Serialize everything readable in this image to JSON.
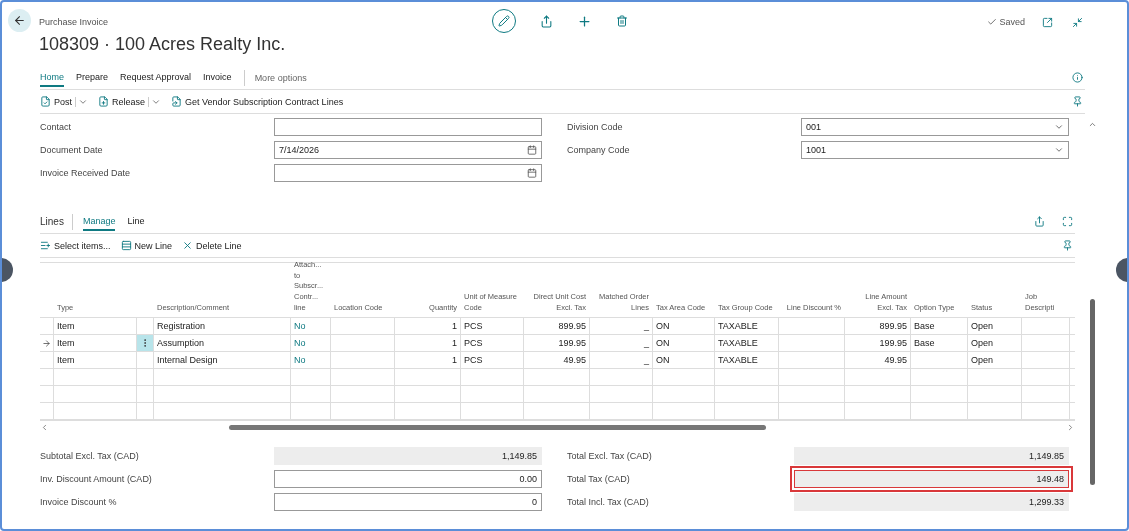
{
  "header": {
    "page_type": "Purchase Invoice",
    "title": "108309 · 100 Acres Realty Inc.",
    "status": "Saved"
  },
  "action_tabs": [
    {
      "label": "Home",
      "selected": true
    },
    {
      "label": "Prepare",
      "selected": false
    },
    {
      "label": "Request Approval",
      "selected": false
    },
    {
      "label": "Invoice",
      "selected": false
    }
  ],
  "more_options": "More options",
  "actions": [
    {
      "label": "Post",
      "dropdown": true
    },
    {
      "label": "Release",
      "dropdown": true
    },
    {
      "label": "Get Vendor Subscription Contract Lines",
      "dropdown": false
    }
  ],
  "form_left": [
    {
      "label": "Contact",
      "kind": "text"
    },
    {
      "label": "Document Date",
      "value": "7/14/2026",
      "kind": "date"
    },
    {
      "label": "Invoice Received Date",
      "kind": "date"
    }
  ],
  "form_right": [
    {
      "label": "Division Code",
      "value": "001",
      "kind": "select"
    },
    {
      "label": "Company Code",
      "value": "1001",
      "kind": "select"
    }
  ],
  "lines": {
    "title": "Lines",
    "tabs": [
      {
        "label": "Manage",
        "selected": true
      },
      {
        "label": "Line",
        "selected": false
      }
    ],
    "actions": [
      "Select items...",
      "New Line",
      "Delete Line"
    ],
    "columns": [
      "Type",
      "Description/Comment",
      "Attach... to Subscr... Contr... line",
      "Location Code",
      "Quantity",
      "Unit of Measure Code",
      "Direct Unit Cost Excl. Tax",
      "Matched Order Lines",
      "Tax Area Code",
      "Tax Group Code",
      "Line Discount %",
      "Line Amount Excl. Tax",
      "Option Type",
      "Status",
      "Job Descripti"
    ],
    "rows": [
      {
        "selected": false,
        "type": "Item",
        "description": "Registration",
        "attach": "No",
        "quantity": "1",
        "unit": "PCS",
        "direct_unit_cost": "899.95",
        "matched": "_",
        "tax_area": "ON",
        "tax_group": "TAXABLE",
        "line_amount": "899.95",
        "option_type": "Base",
        "status": "Open"
      },
      {
        "selected": true,
        "type": "Item",
        "description": "Assumption",
        "attach": "No",
        "quantity": "1",
        "unit": "PCS",
        "direct_unit_cost": "199.95",
        "matched": "_",
        "tax_area": "ON",
        "tax_group": "TAXABLE",
        "line_amount": "199.95",
        "option_type": "Base",
        "status": "Open"
      },
      {
        "selected": false,
        "type": "Item",
        "description": "Internal Design",
        "attach": "No",
        "quantity": "1",
        "unit": "PCS",
        "direct_unit_cost": "49.95",
        "matched": "_",
        "tax_area": "ON",
        "tax_group": "TAXABLE",
        "line_amount": "49.95",
        "status": "Open"
      }
    ]
  },
  "totals_left": [
    {
      "label": "Subtotal Excl. Tax (CAD)",
      "value": "1,149.85",
      "kind": "readonly",
      "highlighted": false
    },
    {
      "label": "Inv. Discount Amount (CAD)",
      "value": "0.00",
      "kind": "input",
      "highlighted": false
    },
    {
      "label": "Invoice Discount %",
      "value": "0",
      "kind": "input",
      "highlighted": false
    }
  ],
  "totals_right": [
    {
      "label": "Total Excl. Tax (CAD)",
      "value": "1,149.85",
      "kind": "readonly",
      "highlighted": false
    },
    {
      "label": "Total Tax (CAD)",
      "value": "149.48",
      "kind": "readonly",
      "highlighted": true
    },
    {
      "label": "Total Incl. Tax (CAD)",
      "value": "1,299.33",
      "kind": "readonly",
      "highlighted": false
    }
  ]
}
